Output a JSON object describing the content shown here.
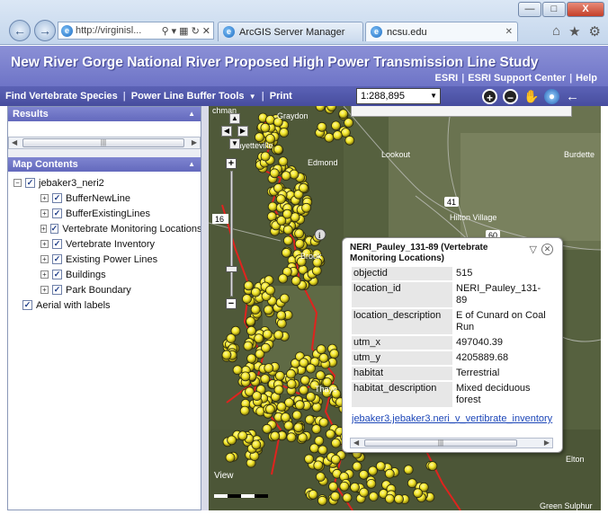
{
  "browser": {
    "address": "http://virginisl...",
    "tabs": [
      {
        "label": "ArcGIS Server Manager"
      },
      {
        "label": "ncsu.edu"
      }
    ],
    "controls": {
      "minimize": "—",
      "maximize": "□",
      "close": "X"
    }
  },
  "app": {
    "title": "New River Gorge National River Proposed High Power Transmission Line Study",
    "links": [
      "ESRI",
      "ESRI Support Center",
      "Help"
    ]
  },
  "toolbar": {
    "items": [
      "Find Vertebrate Species",
      "Power Line Buffer Tools"
    ],
    "print": "Print",
    "scale": "1:288,895"
  },
  "left": {
    "results_title": "Results",
    "map_contents_title": "Map Contents",
    "root_layer": "jebaker3_neri2",
    "layers": [
      "BufferNewLine",
      "BufferExistingLines",
      "Vertebrate Monitoring Locations",
      "Vertebrate Inventory",
      "Existing Power Lines",
      "Buildings",
      "Park Boundary"
    ],
    "basemap": "Aerial with labels"
  },
  "map": {
    "labels": [
      "Graydon",
      "Edmond",
      "Fayetteville",
      "Lookout",
      "Burdette",
      "Hilton Village",
      "Brook",
      "Thaye",
      "View",
      "Elton",
      "Green Sulphur",
      "chman"
    ],
    "road_shields": [
      "16",
      "41",
      "60"
    ],
    "colors": {
      "points": "#f2e526",
      "boundary": "#e0231e",
      "terrain": "#566440"
    }
  },
  "popup": {
    "title": "NERI_Pauley_131-89 (Vertebrate Monitoring Locations)",
    "attributes": [
      {
        "key": "objectid",
        "value": "515"
      },
      {
        "key": "location_id",
        "value": "NERI_Pauley_131-89"
      },
      {
        "key": "location_description",
        "value": "E of Cunard on Coal Run"
      },
      {
        "key": "utm_x",
        "value": "497040.39"
      },
      {
        "key": "utm_y",
        "value": "4205889.68"
      },
      {
        "key": "habitat",
        "value": "Terrestrial"
      },
      {
        "key": "habitat_description",
        "value": "Mixed deciduous forest"
      }
    ],
    "link": "jebaker3.jebaker3.neri_v_vertibrate_inventory"
  }
}
